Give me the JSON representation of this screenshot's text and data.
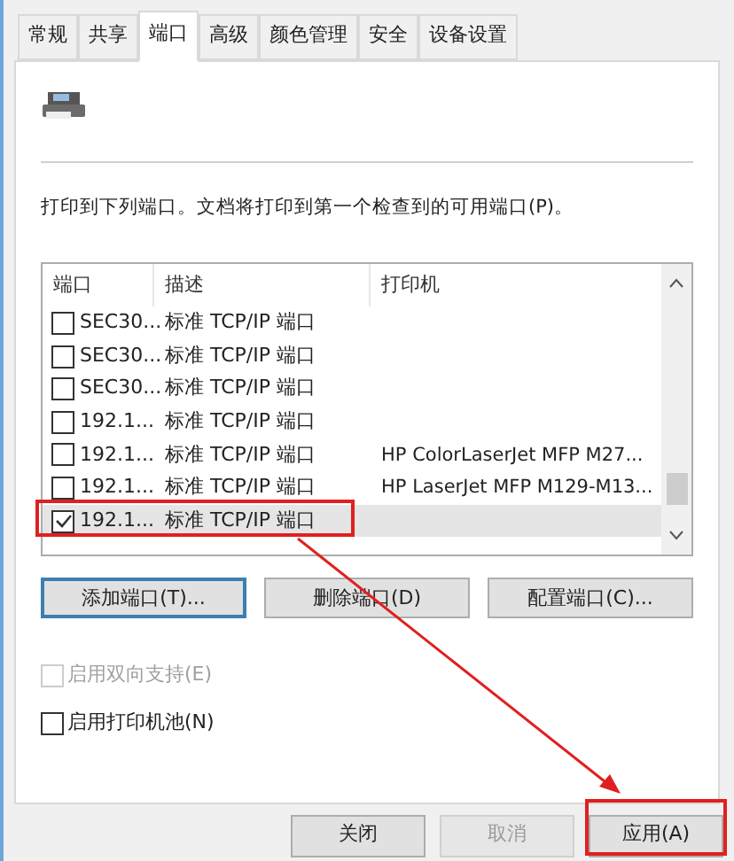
{
  "tabs": [
    {
      "label": "常规",
      "selected": false
    },
    {
      "label": "共享",
      "selected": false
    },
    {
      "label": "端口",
      "selected": true
    },
    {
      "label": "高级",
      "selected": false
    },
    {
      "label": "颜色管理",
      "selected": false
    },
    {
      "label": "安全",
      "selected": false
    },
    {
      "label": "设备设置",
      "selected": false
    }
  ],
  "instruction": "打印到下列端口。文档将打印到第一个检查到的可用端口(P)。",
  "port_table": {
    "columns": [
      "端口",
      "描述",
      "打印机"
    ],
    "rows": [
      {
        "port": "SEC30...",
        "description": "标准 TCP/IP 端口",
        "checked": false,
        "selected": false
      },
      {
        "port": "SEC30...",
        "description": "标准 TCP/IP 端口",
        "checked": false,
        "selected": false
      },
      {
        "port": "SEC30...",
        "description": "标准 TCP/IP 端口",
        "checked": false,
        "selected": false
      },
      {
        "port": "192.1...",
        "description": "标准 TCP/IP 端口",
        "checked": false,
        "selected": false
      },
      {
        "port": "192.1...",
        "description": "标准 TCP/IP 端口",
        "printer": "HP ColorLaserJet MFP M27...",
        "checked": false,
        "selected": false
      },
      {
        "port": "192.1...",
        "description": "标准 TCP/IP 端口",
        "printer": "HP LaserJet MFP M129-M13...",
        "checked": false,
        "selected": false
      },
      {
        "port": "192.1...",
        "description": "标准 TCP/IP 端口",
        "checked": true,
        "selected": true
      }
    ]
  },
  "port_buttons": [
    {
      "label": "添加端口(T)...",
      "focused": true
    },
    {
      "label": "删除端口(D)",
      "focused": false
    },
    {
      "label": "配置端口(C)...",
      "focused": false
    }
  ],
  "options": [
    {
      "label": "启用双向支持(E)",
      "checked": false,
      "disabled": true
    },
    {
      "label": "启用打印机池(N)",
      "checked": false,
      "disabled": false
    }
  ],
  "dialog_buttons": [
    {
      "label": "关闭",
      "disabled": false
    },
    {
      "label": "取消",
      "disabled": true
    },
    {
      "label": "应用(A)",
      "disabled": false
    }
  ]
}
